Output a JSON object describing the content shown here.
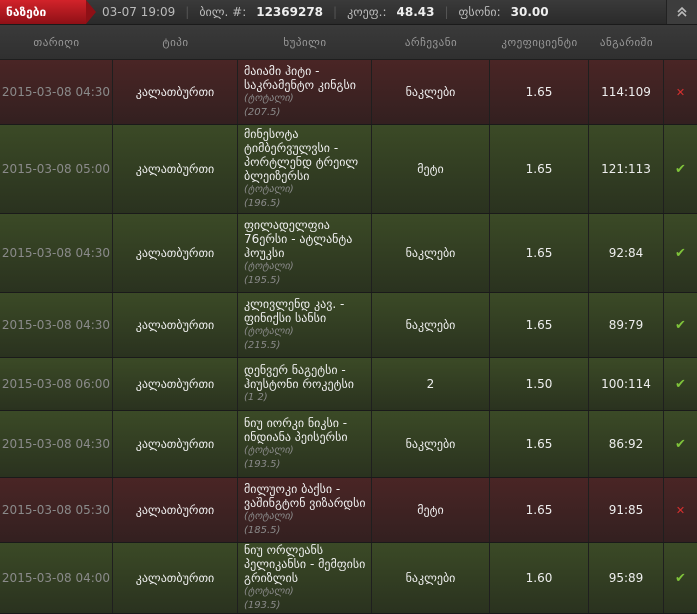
{
  "topbar": {
    "tag": "ნაზები",
    "datetime": "03-07 19:09",
    "ticket_label": "ბილ. #:",
    "ticket_no": "12369278",
    "coef_label": "კოეფ.:",
    "coef": "48.43",
    "amount_label": "ფსონი:",
    "amount": "30.00"
  },
  "columns": [
    "თარიღი",
    "ტიპი",
    "ხუპილი",
    "არჩევანი",
    "კოეფიციენტი",
    "ანგარიში"
  ],
  "rows": [
    {
      "date": "2015-03-08 04:30",
      "type": "კალათბურთი",
      "event": "მაიამი ჰიტი - საკრამენტო კინგსი",
      "sub1": "(ტოტალი)",
      "sub2": "(207.5)",
      "choice": "ნაკლები",
      "odd": "1.65",
      "score": "114:109",
      "status": "lost"
    },
    {
      "date": "2015-03-08 05:00",
      "type": "კალათბურთი",
      "event": "მინესოტა ტიმბერვულვსი - პორტლენდ ტრეილ ბლეიზერსი",
      "sub1": "(ტოტალი)",
      "sub2": "(196.5)",
      "choice": "მეტი",
      "odd": "1.65",
      "score": "121:113",
      "status": "won"
    },
    {
      "date": "2015-03-08 04:30",
      "type": "კალათბურთი",
      "event": "ფილადელფია 76ერსი - ატლანტა ჰოუკსი",
      "sub1": "(ტოტალი)",
      "sub2": "(195.5)",
      "choice": "ნაკლები",
      "odd": "1.65",
      "score": "92:84",
      "status": "won"
    },
    {
      "date": "2015-03-08 04:30",
      "type": "კალათბურთი",
      "event": "კლივლენდ კავ. - ფინიქსი სანსი",
      "sub1": "(ტოტალი)",
      "sub2": "(215.5)",
      "choice": "ნაკლები",
      "odd": "1.65",
      "score": "89:79",
      "status": "won"
    },
    {
      "date": "2015-03-08 06:00",
      "type": "კალათბურთი",
      "event": "დენვერ ნაგეტსი - ჰიუსტონი როკეტსი",
      "sub1": "(1 2)",
      "sub2": "",
      "choice": "2",
      "odd": "1.50",
      "score": "100:114",
      "status": "won"
    },
    {
      "date": "2015-03-08 04:30",
      "type": "კალათბურთი",
      "event": "ნიუ იორკი ნიკსი - ინდიანა პეისერსი",
      "sub1": "(ტოტალი)",
      "sub2": "(193.5)",
      "choice": "ნაკლები",
      "odd": "1.65",
      "score": "86:92",
      "status": "won"
    },
    {
      "date": "2015-03-08 05:30",
      "type": "კალათბურთი",
      "event": "მილუოკი ბაქსი - ვაშინგტონ ვიზარდსი",
      "sub1": "(ტოტალი)",
      "sub2": "(185.5)",
      "choice": "მეტი",
      "odd": "1.65",
      "score": "91:85",
      "status": "lost"
    },
    {
      "date": "2015-03-08 04:00",
      "type": "კალათბურთი",
      "event": "ნიუ ორლეანს პელიკანსი - მემფისი გრიზლის",
      "sub1": "(ტოტალი)",
      "sub2": "(193.5)",
      "choice": "ნაკლები",
      "odd": "1.60",
      "score": "95:89",
      "status": "won"
    }
  ],
  "icons": {
    "lost": "cross-icon",
    "won": "check-icon",
    "collapse": "chevron-up-icon"
  }
}
